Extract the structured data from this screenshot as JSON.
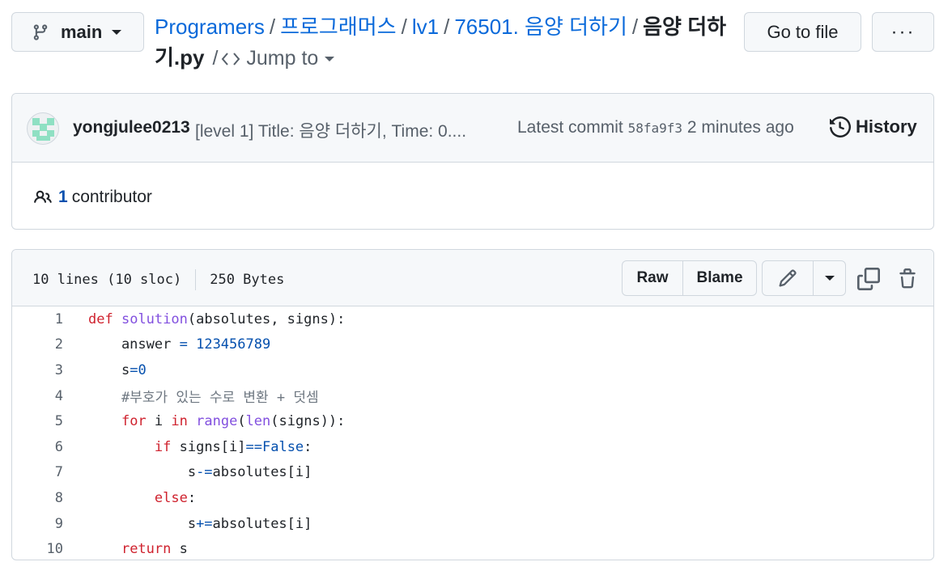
{
  "branch": {
    "label": "main",
    "icon": "git-branch-icon"
  },
  "breadcrumb": {
    "repo": "Programers",
    "parts": [
      "프로그래머스",
      "lv1",
      "76501. 음양 더하기"
    ],
    "current": "음양 더하기.py",
    "jump_label": "Jump to",
    "jump_icon": "code-icon"
  },
  "toolbar": {
    "go_to_file": "Go to file",
    "more": "···"
  },
  "commit": {
    "author": "yongjulee0213",
    "message": "[level 1] Title: 음양 더하기, Time: 0....",
    "latest_label": "Latest commit",
    "sha": "58fa9f3",
    "time": "2 minutes ago",
    "history_label": "History"
  },
  "contributors": {
    "count": "1",
    "label": "contributor"
  },
  "file": {
    "lines_info": "10 lines (10 sloc)",
    "size": "250 Bytes",
    "raw_label": "Raw",
    "blame_label": "Blame"
  },
  "code_lines": [
    {
      "n": "1",
      "tokens": [
        [
          "kw",
          "def"
        ],
        [
          "",
          " "
        ],
        [
          "fn",
          "solution"
        ],
        [
          "",
          "(absolutes, signs):"
        ]
      ]
    },
    {
      "n": "2",
      "tokens": [
        [
          "",
          "    answer "
        ],
        [
          "op",
          "="
        ],
        [
          "",
          " "
        ],
        [
          "num",
          "123456789"
        ]
      ]
    },
    {
      "n": "3",
      "tokens": [
        [
          "",
          "    s"
        ],
        [
          "op",
          "="
        ],
        [
          "num",
          "0"
        ]
      ]
    },
    {
      "n": "4",
      "tokens": [
        [
          "cm",
          "    #부호가 있는 수로 변환 + 덧셈"
        ]
      ]
    },
    {
      "n": "5",
      "tokens": [
        [
          "",
          "    "
        ],
        [
          "kw",
          "for"
        ],
        [
          "",
          " i "
        ],
        [
          "kw",
          "in"
        ],
        [
          "",
          " "
        ],
        [
          "fn",
          "range"
        ],
        [
          "",
          "("
        ],
        [
          "fn",
          "len"
        ],
        [
          "",
          "(signs)):"
        ]
      ]
    },
    {
      "n": "6",
      "tokens": [
        [
          "",
          "        "
        ],
        [
          "kw",
          "if"
        ],
        [
          "",
          " signs[i]"
        ],
        [
          "op",
          "=="
        ],
        [
          "num",
          "False"
        ],
        [
          "",
          ":"
        ]
      ]
    },
    {
      "n": "7",
      "tokens": [
        [
          "",
          "            s"
        ],
        [
          "op",
          "-="
        ],
        [
          "",
          "absolutes[i]"
        ]
      ]
    },
    {
      "n": "8",
      "tokens": [
        [
          "",
          "        "
        ],
        [
          "kw",
          "else"
        ],
        [
          "",
          ":"
        ]
      ]
    },
    {
      "n": "9",
      "tokens": [
        [
          "",
          "            s"
        ],
        [
          "op",
          "+="
        ],
        [
          "",
          "absolutes[i]"
        ]
      ]
    },
    {
      "n": "10",
      "tokens": [
        [
          "",
          "    "
        ],
        [
          "kw",
          "return"
        ],
        [
          "",
          " s"
        ]
      ]
    }
  ]
}
